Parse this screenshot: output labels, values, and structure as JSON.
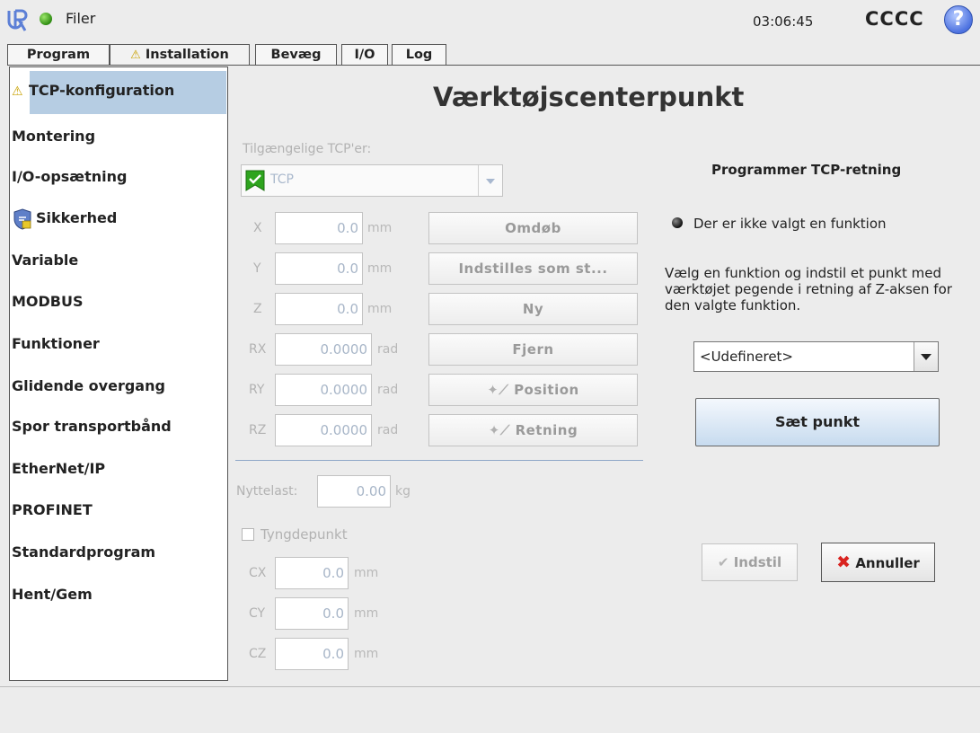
{
  "header": {
    "file_menu": "Filer",
    "clock": "03:06:45",
    "robot_name": "CCCC",
    "help": "?"
  },
  "tabs": [
    {
      "label": "Program"
    },
    {
      "label": "Installation",
      "warning": true,
      "active": true
    },
    {
      "label": "Bevæg"
    },
    {
      "label": "I/O"
    },
    {
      "label": "Log"
    }
  ],
  "sidebar": {
    "items": [
      {
        "label": "TCP-konfiguration",
        "active": true,
        "warning": true
      },
      {
        "label": "Montering"
      },
      {
        "label": "I/O-opsætning"
      },
      {
        "label": "Sikkerhed",
        "icon": "shield-icon"
      },
      {
        "label": "Variable"
      },
      {
        "label": "MODBUS"
      },
      {
        "label": "Funktioner"
      },
      {
        "label": "Glidende overgang"
      },
      {
        "label": "Spor transportbånd"
      },
      {
        "label": "EtherNet/IP"
      },
      {
        "label": "PROFINET"
      },
      {
        "label": "Standardprogram"
      },
      {
        "label": "Hent/Gem"
      }
    ]
  },
  "main": {
    "title": "Værktøjscenterpunkt",
    "available_tcps_label": "Tilgængelige TCP'er:",
    "tcp_selected": "TCP",
    "coords": [
      {
        "label": "X",
        "value": "0.0",
        "unit": "mm"
      },
      {
        "label": "Y",
        "value": "0.0",
        "unit": "mm"
      },
      {
        "label": "Z",
        "value": "0.0",
        "unit": "mm"
      },
      {
        "label": "RX",
        "value": "0.0000",
        "unit": "rad"
      },
      {
        "label": "RY",
        "value": "0.0000",
        "unit": "rad"
      },
      {
        "label": "RZ",
        "value": "0.0000",
        "unit": "rad"
      }
    ],
    "buttons": {
      "rename": "Omdøb",
      "set_default": "Indstilles som st...",
      "new": "Ny",
      "remove": "Fjern",
      "position": "Position",
      "orientation": "Retning"
    },
    "payload": {
      "label": "Nyttelast:",
      "value": "0.00",
      "unit": "kg"
    },
    "cog": {
      "checkbox_label": "Tyngdepunkt",
      "fields": [
        {
          "label": "CX",
          "value": "0.0",
          "unit": "mm"
        },
        {
          "label": "CY",
          "value": "0.0",
          "unit": "mm"
        },
        {
          "label": "CZ",
          "value": "0.0",
          "unit": "mm"
        }
      ]
    }
  },
  "right": {
    "title": "Programmer TCP-retning",
    "status": "Der er ikke valgt en funktion",
    "instructions": "Vælg en funktion og indstil et punkt med værktøjet pegende i retning af Z-aksen for den valgte funktion.",
    "feature_select": "<Udefineret>",
    "set_point": "Sæt punkt",
    "apply": "Indstil",
    "cancel": "Annuller"
  },
  "colors": {
    "accent": "#b6cde3",
    "warning": "#f2c200",
    "tcp_green": "#2ea41e",
    "cancel_x": "#d9231f"
  }
}
